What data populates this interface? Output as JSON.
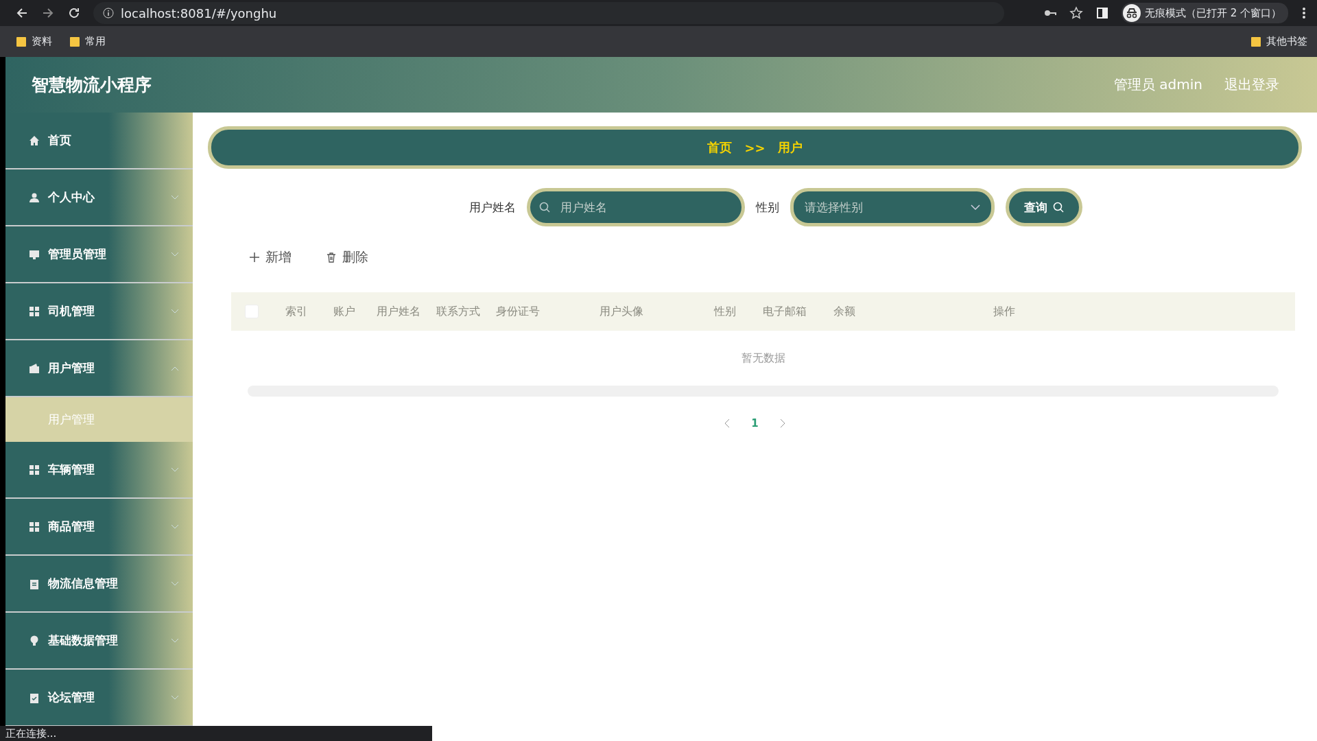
{
  "browser": {
    "url": "localhost:8081/#/yonghu",
    "profile": "无痕模式（已打开 2 个窗口）",
    "bookmarks": [
      "资料",
      "常用"
    ],
    "other_bookmarks": "其他书签"
  },
  "header": {
    "title": "智慧物流小程序",
    "user": "管理员 admin",
    "logout": "退出登录"
  },
  "sidebar": {
    "items": [
      {
        "label": "首页"
      },
      {
        "label": "个人中心",
        "expanded": false
      },
      {
        "label": "管理员管理",
        "expanded": false
      },
      {
        "label": "司机管理",
        "expanded": false
      },
      {
        "label": "用户管理",
        "expanded": true,
        "children": [
          {
            "label": "用户管理",
            "selected": true
          }
        ]
      },
      {
        "label": "车辆管理",
        "expanded": false
      },
      {
        "label": "商品管理",
        "expanded": false
      },
      {
        "label": "物流信息管理",
        "expanded": false
      },
      {
        "label": "基础数据管理",
        "expanded": false
      },
      {
        "label": "论坛管理",
        "expanded": false
      }
    ]
  },
  "breadcrumb": [
    "首页",
    ">>",
    "用户"
  ],
  "search": {
    "name_label": "用户姓名",
    "name_placeholder": "用户姓名",
    "gender_label": "性别",
    "gender_placeholder": "请选择性别",
    "query": "查询"
  },
  "actions": {
    "add": "新增",
    "delete": "删除"
  },
  "table": {
    "select_all": {
      "checked": false
    },
    "columns": [
      "索引",
      "账户",
      "用户姓名",
      "联系方式",
      "身份证号",
      "用户头像",
      "性别",
      "电子邮箱",
      "余额",
      "操作"
    ],
    "empty": "暂无数据"
  },
  "pagination": {
    "pages": [
      {
        "label": "1",
        "selected": true
      }
    ]
  },
  "status_bar": "正在连接..."
}
